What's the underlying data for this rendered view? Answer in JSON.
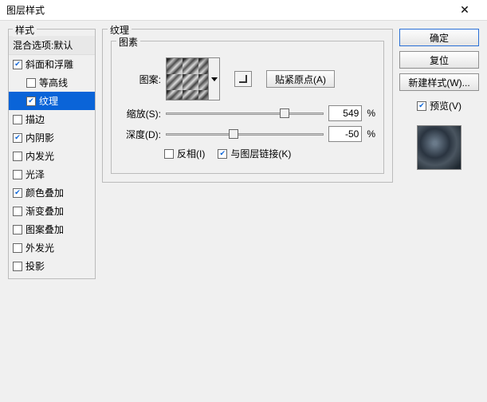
{
  "window": {
    "title": "图层样式",
    "close": "✕"
  },
  "styles": {
    "header": "样式",
    "blend": "混合选项:默认",
    "items": [
      {
        "label": "斜面和浮雕",
        "checked": true,
        "indent": false,
        "selected": false
      },
      {
        "label": "等高线",
        "checked": false,
        "indent": true,
        "selected": false
      },
      {
        "label": "纹理",
        "checked": true,
        "indent": true,
        "selected": true
      },
      {
        "label": "描边",
        "checked": false,
        "indent": false,
        "selected": false
      },
      {
        "label": "内阴影",
        "checked": true,
        "indent": false,
        "selected": false
      },
      {
        "label": "内发光",
        "checked": false,
        "indent": false,
        "selected": false
      },
      {
        "label": "光泽",
        "checked": false,
        "indent": false,
        "selected": false
      },
      {
        "label": "颜色叠加",
        "checked": true,
        "indent": false,
        "selected": false
      },
      {
        "label": "渐变叠加",
        "checked": false,
        "indent": false,
        "selected": false
      },
      {
        "label": "图案叠加",
        "checked": false,
        "indent": false,
        "selected": false
      },
      {
        "label": "外发光",
        "checked": false,
        "indent": false,
        "selected": false
      },
      {
        "label": "投影",
        "checked": false,
        "indent": false,
        "selected": false
      }
    ]
  },
  "texture": {
    "group": "纹理",
    "elements": "图素",
    "pattern_label": "图案:",
    "snap_origin": "贴紧原点(A)",
    "scale_label": "缩放(S):",
    "scale_value": "549",
    "depth_label": "深度(D):",
    "depth_value": "-50",
    "pct": "%",
    "invert": "反相(I)",
    "invert_checked": false,
    "link_layer": "与图层链接(K)",
    "link_checked": true
  },
  "buttons": {
    "ok": "确定",
    "cancel": "复位",
    "new_style": "新建样式(W)...",
    "preview": "预览(V)",
    "preview_checked": true
  }
}
